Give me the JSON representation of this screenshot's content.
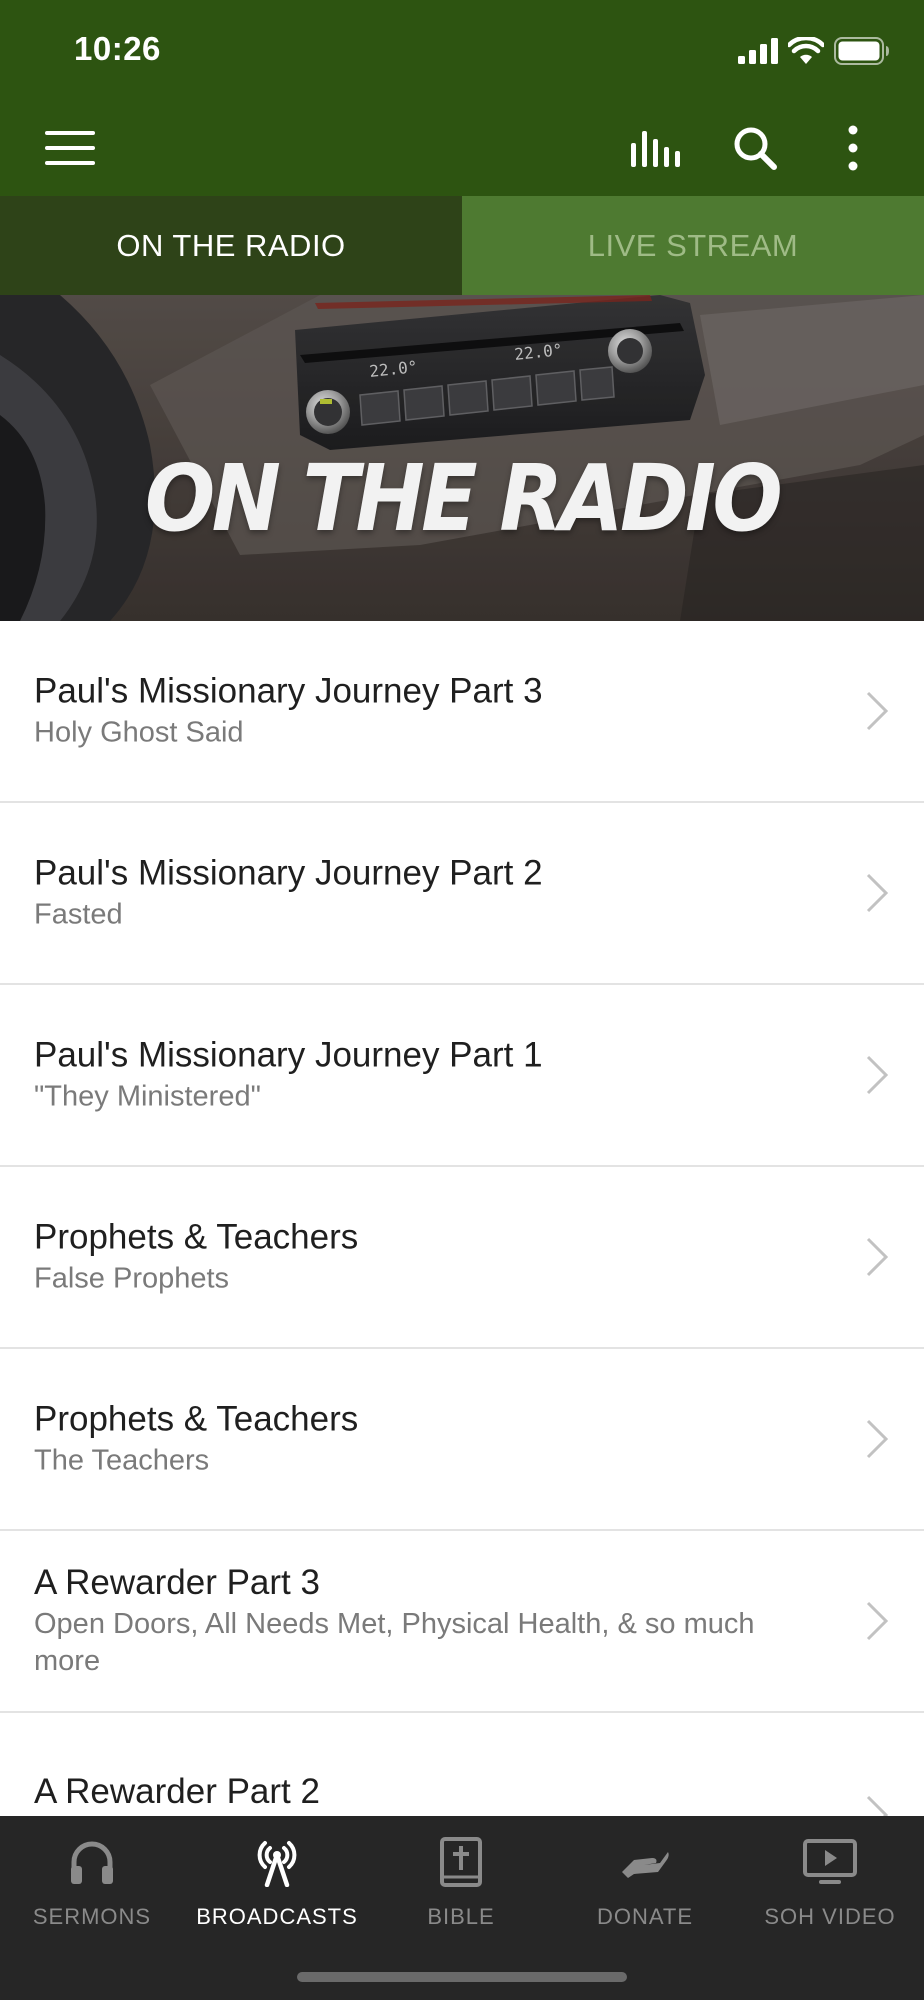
{
  "status_bar": {
    "time": "10:26"
  },
  "tabs": [
    {
      "label": "ON THE RADIO",
      "active": true
    },
    {
      "label": "LIVE STREAM",
      "active": false
    }
  ],
  "hero": {
    "title": "ON THE RADIO",
    "display_left": "22.0°",
    "display_right": "22.0°"
  },
  "list": [
    {
      "title": "Paul's Missionary Journey Part 3",
      "subtitle": "Holy Ghost Said"
    },
    {
      "title": "Paul's Missionary Journey Part 2",
      "subtitle": "Fasted"
    },
    {
      "title": "Paul's Missionary Journey Part 1",
      "subtitle": "\"They Ministered\""
    },
    {
      "title": "Prophets & Teachers",
      "subtitle": "False Prophets"
    },
    {
      "title": "Prophets & Teachers",
      "subtitle": "The Teachers"
    },
    {
      "title": "A Rewarder Part 3",
      "subtitle": "Open Doors, All Needs Met, Physical Health, & so much more"
    },
    {
      "title": "A Rewarder Part 2",
      "subtitle": ""
    }
  ],
  "bottom_nav": [
    {
      "label": "SERMONS",
      "icon": "headphones-icon",
      "active": false
    },
    {
      "label": "BROADCASTS",
      "icon": "broadcast-antenna-icon",
      "active": true
    },
    {
      "label": "BIBLE",
      "icon": "bible-icon",
      "active": false
    },
    {
      "label": "DONATE",
      "icon": "donate-hand-icon",
      "active": false
    },
    {
      "label": "SOH VIDEO",
      "icon": "video-play-icon",
      "active": false
    }
  ],
  "colors": {
    "app_bar": "#2d5411",
    "tab_active_bg": "#2e4318",
    "tab_inactive_bg": "#4e7a31",
    "tab_inactive_text": "#9fbb86",
    "bottom_nav_bg": "#262626"
  }
}
